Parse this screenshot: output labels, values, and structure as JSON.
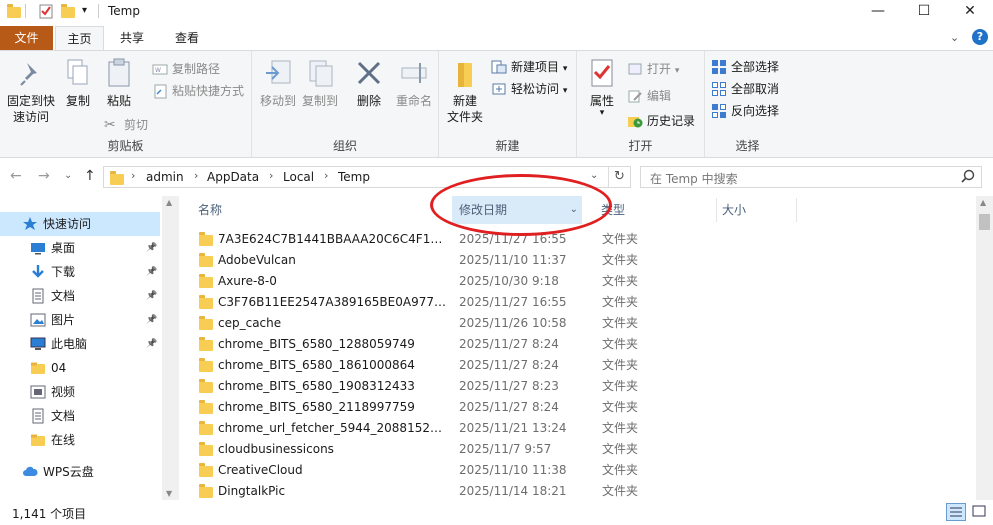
{
  "window": {
    "title": "Temp",
    "controls": {
      "minimize": "—",
      "maximize": "☐",
      "close": "✕"
    }
  },
  "tabs": {
    "file": "文件",
    "home": "主页",
    "share": "共享",
    "view": "查看"
  },
  "ribbon": {
    "clipboard": {
      "label": "剪贴板",
      "pin_quick_access": "固定到快速访问",
      "copy": "复制",
      "paste": "粘贴",
      "copy_path": "复制路径",
      "paste_shortcut": "粘贴快捷方式",
      "cut": "剪切"
    },
    "organize": {
      "label": "组织",
      "move_to": "移动到",
      "copy_to": "复制到",
      "delete": "删除",
      "rename": "重命名"
    },
    "new": {
      "label": "新建",
      "new_folder": "新建\n文件夹",
      "new_item": "新建项目",
      "easy_access": "轻松访问"
    },
    "open": {
      "label": "打开",
      "properties": "属性",
      "open": "打开",
      "edit": "编辑",
      "history": "历史记录"
    },
    "select": {
      "label": "选择",
      "select_all": "全部选择",
      "select_none": "全部取消",
      "invert": "反向选择"
    }
  },
  "address": {
    "crumbs": [
      "admin",
      "AppData",
      "Local",
      "Temp"
    ],
    "search_placeholder": "在 Temp 中搜索"
  },
  "sidebar": {
    "items": [
      {
        "label": "快速访问",
        "icon": "star-icon",
        "pinned": false
      },
      {
        "label": "桌面",
        "icon": "desktop-icon",
        "pinned": true
      },
      {
        "label": "下载",
        "icon": "download-icon",
        "pinned": true
      },
      {
        "label": "文档",
        "icon": "document-icon",
        "pinned": true
      },
      {
        "label": "图片",
        "icon": "picture-icon",
        "pinned": true
      },
      {
        "label": "此电脑",
        "icon": "computer-icon",
        "pinned": true
      },
      {
        "label": "04",
        "icon": "folder-icon",
        "pinned": false
      },
      {
        "label": "视频",
        "icon": "video-icon",
        "pinned": false
      },
      {
        "label": "文档",
        "icon": "document-icon",
        "pinned": false
      },
      {
        "label": "在线",
        "icon": "folder-icon",
        "pinned": false
      },
      {
        "label": "WPS云盘",
        "icon": "cloud-icon",
        "pinned": false
      }
    ]
  },
  "filelist": {
    "headers": {
      "name": "名称",
      "date": "修改日期",
      "type": "类型",
      "size": "大小"
    },
    "rows": [
      {
        "name": "7A3E624C7B1441BBAAA20C6C4F140...",
        "date": "2025/11/27 16:55",
        "type": "文件夹"
      },
      {
        "name": "AdobeVulcan",
        "date": "2025/11/10 11:37",
        "type": "文件夹"
      },
      {
        "name": "Axure-8-0",
        "date": "2025/10/30 9:18",
        "type": "文件夹"
      },
      {
        "name": "C3F76B11EE2547A389165BE0A97777...",
        "date": "2025/11/27 16:55",
        "type": "文件夹"
      },
      {
        "name": "cep_cache",
        "date": "2025/11/26 10:58",
        "type": "文件夹"
      },
      {
        "name": "chrome_BITS_6580_1288059749",
        "date": "2025/11/27 8:24",
        "type": "文件夹"
      },
      {
        "name": "chrome_BITS_6580_1861000864",
        "date": "2025/11/27 8:24",
        "type": "文件夹"
      },
      {
        "name": "chrome_BITS_6580_1908312433",
        "date": "2025/11/27 8:23",
        "type": "文件夹"
      },
      {
        "name": "chrome_BITS_6580_2118997759",
        "date": "2025/11/27 8:24",
        "type": "文件夹"
      },
      {
        "name": "chrome_url_fetcher_5944_2088152870",
        "date": "2025/11/21 13:24",
        "type": "文件夹"
      },
      {
        "name": "cloudbusinessicons",
        "date": "2025/11/7 9:57",
        "type": "文件夹"
      },
      {
        "name": "CreativeCloud",
        "date": "2025/11/10 11:38",
        "type": "文件夹"
      },
      {
        "name": "DingtalkPic",
        "date": "2025/11/14 18:21",
        "type": "文件夹"
      }
    ]
  },
  "status": {
    "count": "1,141 个项目"
  },
  "colors": {
    "file_tab": "#b85a17",
    "selected_nav": "#cce8ff",
    "folder": "#f7cd54",
    "annotation": "#e02020"
  }
}
